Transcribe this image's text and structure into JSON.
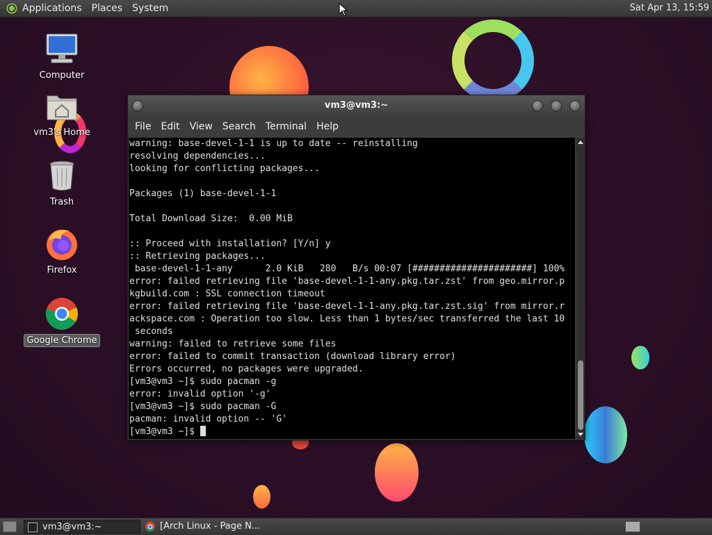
{
  "top_panel": {
    "menus": [
      "Applications",
      "Places",
      "System"
    ],
    "clock": "Sat Apr 13, 15:59"
  },
  "desktop": {
    "icons": [
      {
        "label": "Computer",
        "icon": "computer-icon"
      },
      {
        "label": "vm3's Home",
        "icon": "home-folder-icon"
      },
      {
        "label": "Trash",
        "icon": "trash-icon"
      },
      {
        "label": "Firefox",
        "icon": "firefox-icon"
      },
      {
        "label": "Google Chrome",
        "icon": "chrome-icon"
      }
    ]
  },
  "terminal": {
    "title": "vm3@vm3:~",
    "menus": [
      "File",
      "Edit",
      "View",
      "Search",
      "Terminal",
      "Help"
    ],
    "lines": [
      "warning: base-devel-1-1 is up to date -- reinstalling",
      "resolving dependencies...",
      "looking for conflicting packages...",
      "",
      "Packages (1) base-devel-1-1",
      "",
      "Total Download Size:  0.00 MiB",
      "",
      ":: Proceed with installation? [Y/n] y",
      ":: Retrieving packages...",
      " base-devel-1-1-any      2.0 KiB   280   B/s 00:07 [######################] 100%",
      "error: failed retrieving file 'base-devel-1-1-any.pkg.tar.zst' from geo.mirror.p",
      "kgbuild.com : SSL connection timeout",
      "error: failed retrieving file 'base-devel-1-1-any.pkg.tar.zst.sig' from mirror.r",
      "ackspace.com : Operation too slow. Less than 1 bytes/sec transferred the last 10",
      " seconds",
      "warning: failed to retrieve some files",
      "error: failed to commit transaction (download library error)",
      "Errors occurred, no packages were upgraded.",
      "[vm3@vm3 ~]$ sudo pacman -g",
      "error: invalid option '-g'",
      "[vm3@vm3 ~]$ sudo pacman -G",
      "pacman: invalid option -- 'G'"
    ],
    "prompt": "[vm3@vm3 ~]$ "
  },
  "taskbar": {
    "tasks": [
      {
        "label": "vm3@vm3:~",
        "icon": "terminal-icon"
      },
      {
        "label": "[Arch Linux - Page N...",
        "icon": "chrome-icon"
      }
    ]
  }
}
